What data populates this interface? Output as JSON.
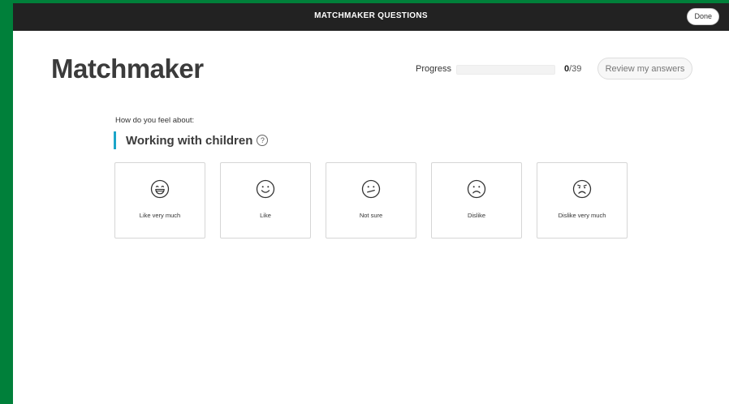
{
  "topbar": {
    "title": "MATCHMAKER QUESTIONS",
    "done_label": "Done"
  },
  "page": {
    "title": "Matchmaker"
  },
  "progress": {
    "label": "Progress",
    "current": "0",
    "total": "/39",
    "fraction": 0,
    "review_label": "Review my answers"
  },
  "question": {
    "prompt": "How do you feel about:",
    "text": "Working with children",
    "help_glyph": "?",
    "accent_color": "#1ba5c9"
  },
  "options": [
    {
      "label": "Like very much",
      "icon": "grin-face-icon"
    },
    {
      "label": "Like",
      "icon": "smile-face-icon"
    },
    {
      "label": "Not sure",
      "icon": "unsure-face-icon"
    },
    {
      "label": "Dislike",
      "icon": "frown-face-icon"
    },
    {
      "label": "Dislike very much",
      "icon": "very-sad-face-icon"
    }
  ]
}
